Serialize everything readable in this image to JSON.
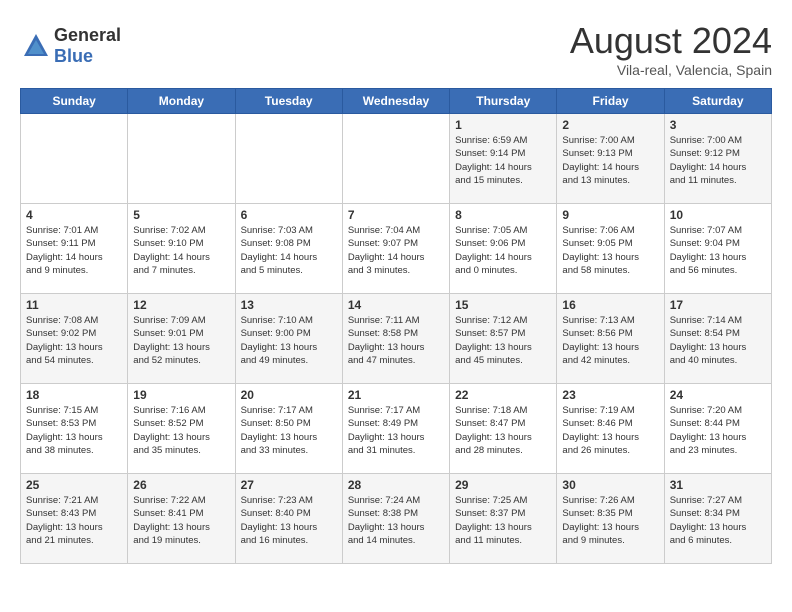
{
  "header": {
    "logo_general": "General",
    "logo_blue": "Blue",
    "title": "August 2024",
    "location": "Vila-real, Valencia, Spain"
  },
  "calendar": {
    "days_of_week": [
      "Sunday",
      "Monday",
      "Tuesday",
      "Wednesday",
      "Thursday",
      "Friday",
      "Saturday"
    ],
    "weeks": [
      [
        {
          "day": "",
          "content": ""
        },
        {
          "day": "",
          "content": ""
        },
        {
          "day": "",
          "content": ""
        },
        {
          "day": "",
          "content": ""
        },
        {
          "day": "1",
          "content": "Sunrise: 6:59 AM\nSunset: 9:14 PM\nDaylight: 14 hours\nand 15 minutes."
        },
        {
          "day": "2",
          "content": "Sunrise: 7:00 AM\nSunset: 9:13 PM\nDaylight: 14 hours\nand 13 minutes."
        },
        {
          "day": "3",
          "content": "Sunrise: 7:00 AM\nSunset: 9:12 PM\nDaylight: 14 hours\nand 11 minutes."
        }
      ],
      [
        {
          "day": "4",
          "content": "Sunrise: 7:01 AM\nSunset: 9:11 PM\nDaylight: 14 hours\nand 9 minutes."
        },
        {
          "day": "5",
          "content": "Sunrise: 7:02 AM\nSunset: 9:10 PM\nDaylight: 14 hours\nand 7 minutes."
        },
        {
          "day": "6",
          "content": "Sunrise: 7:03 AM\nSunset: 9:08 PM\nDaylight: 14 hours\nand 5 minutes."
        },
        {
          "day": "7",
          "content": "Sunrise: 7:04 AM\nSunset: 9:07 PM\nDaylight: 14 hours\nand 3 minutes."
        },
        {
          "day": "8",
          "content": "Sunrise: 7:05 AM\nSunset: 9:06 PM\nDaylight: 14 hours\nand 0 minutes."
        },
        {
          "day": "9",
          "content": "Sunrise: 7:06 AM\nSunset: 9:05 PM\nDaylight: 13 hours\nand 58 minutes."
        },
        {
          "day": "10",
          "content": "Sunrise: 7:07 AM\nSunset: 9:04 PM\nDaylight: 13 hours\nand 56 minutes."
        }
      ],
      [
        {
          "day": "11",
          "content": "Sunrise: 7:08 AM\nSunset: 9:02 PM\nDaylight: 13 hours\nand 54 minutes."
        },
        {
          "day": "12",
          "content": "Sunrise: 7:09 AM\nSunset: 9:01 PM\nDaylight: 13 hours\nand 52 minutes."
        },
        {
          "day": "13",
          "content": "Sunrise: 7:10 AM\nSunset: 9:00 PM\nDaylight: 13 hours\nand 49 minutes."
        },
        {
          "day": "14",
          "content": "Sunrise: 7:11 AM\nSunset: 8:58 PM\nDaylight: 13 hours\nand 47 minutes."
        },
        {
          "day": "15",
          "content": "Sunrise: 7:12 AM\nSunset: 8:57 PM\nDaylight: 13 hours\nand 45 minutes."
        },
        {
          "day": "16",
          "content": "Sunrise: 7:13 AM\nSunset: 8:56 PM\nDaylight: 13 hours\nand 42 minutes."
        },
        {
          "day": "17",
          "content": "Sunrise: 7:14 AM\nSunset: 8:54 PM\nDaylight: 13 hours\nand 40 minutes."
        }
      ],
      [
        {
          "day": "18",
          "content": "Sunrise: 7:15 AM\nSunset: 8:53 PM\nDaylight: 13 hours\nand 38 minutes."
        },
        {
          "day": "19",
          "content": "Sunrise: 7:16 AM\nSunset: 8:52 PM\nDaylight: 13 hours\nand 35 minutes."
        },
        {
          "day": "20",
          "content": "Sunrise: 7:17 AM\nSunset: 8:50 PM\nDaylight: 13 hours\nand 33 minutes."
        },
        {
          "day": "21",
          "content": "Sunrise: 7:17 AM\nSunset: 8:49 PM\nDaylight: 13 hours\nand 31 minutes."
        },
        {
          "day": "22",
          "content": "Sunrise: 7:18 AM\nSunset: 8:47 PM\nDaylight: 13 hours\nand 28 minutes."
        },
        {
          "day": "23",
          "content": "Sunrise: 7:19 AM\nSunset: 8:46 PM\nDaylight: 13 hours\nand 26 minutes."
        },
        {
          "day": "24",
          "content": "Sunrise: 7:20 AM\nSunset: 8:44 PM\nDaylight: 13 hours\nand 23 minutes."
        }
      ],
      [
        {
          "day": "25",
          "content": "Sunrise: 7:21 AM\nSunset: 8:43 PM\nDaylight: 13 hours\nand 21 minutes."
        },
        {
          "day": "26",
          "content": "Sunrise: 7:22 AM\nSunset: 8:41 PM\nDaylight: 13 hours\nand 19 minutes."
        },
        {
          "day": "27",
          "content": "Sunrise: 7:23 AM\nSunset: 8:40 PM\nDaylight: 13 hours\nand 16 minutes."
        },
        {
          "day": "28",
          "content": "Sunrise: 7:24 AM\nSunset: 8:38 PM\nDaylight: 13 hours\nand 14 minutes."
        },
        {
          "day": "29",
          "content": "Sunrise: 7:25 AM\nSunset: 8:37 PM\nDaylight: 13 hours\nand 11 minutes."
        },
        {
          "day": "30",
          "content": "Sunrise: 7:26 AM\nSunset: 8:35 PM\nDaylight: 13 hours\nand 9 minutes."
        },
        {
          "day": "31",
          "content": "Sunrise: 7:27 AM\nSunset: 8:34 PM\nDaylight: 13 hours\nand 6 minutes."
        }
      ]
    ]
  }
}
